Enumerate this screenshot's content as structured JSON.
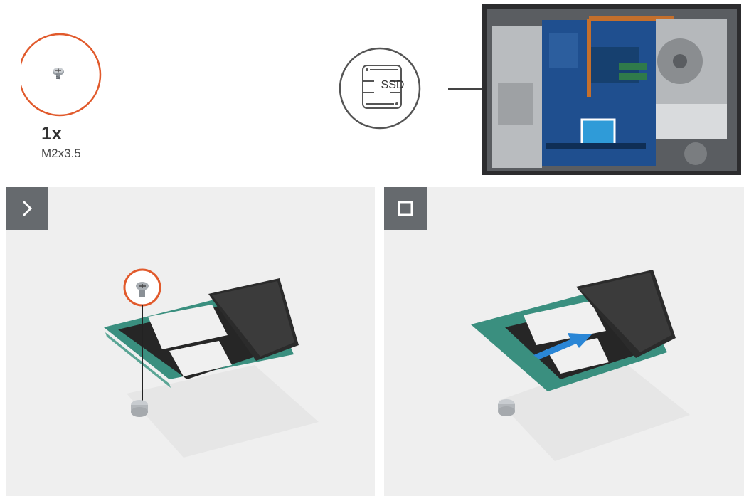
{
  "screw": {
    "quantity": "1x",
    "size": "M2x3.5"
  },
  "callout": {
    "label": "SSD"
  },
  "steps": [
    {
      "icon": "chevron-right-icon"
    },
    {
      "icon": "square-stop-icon"
    }
  ],
  "colors": {
    "accent": "#e15a2c",
    "badge": "#666a6e",
    "panel": "#efefef",
    "pcb_green": "#3a8f7f",
    "motherboard_blue": "#1f4f8f",
    "highlight": "#2f9bd8",
    "arrow": "#2a86d6"
  }
}
